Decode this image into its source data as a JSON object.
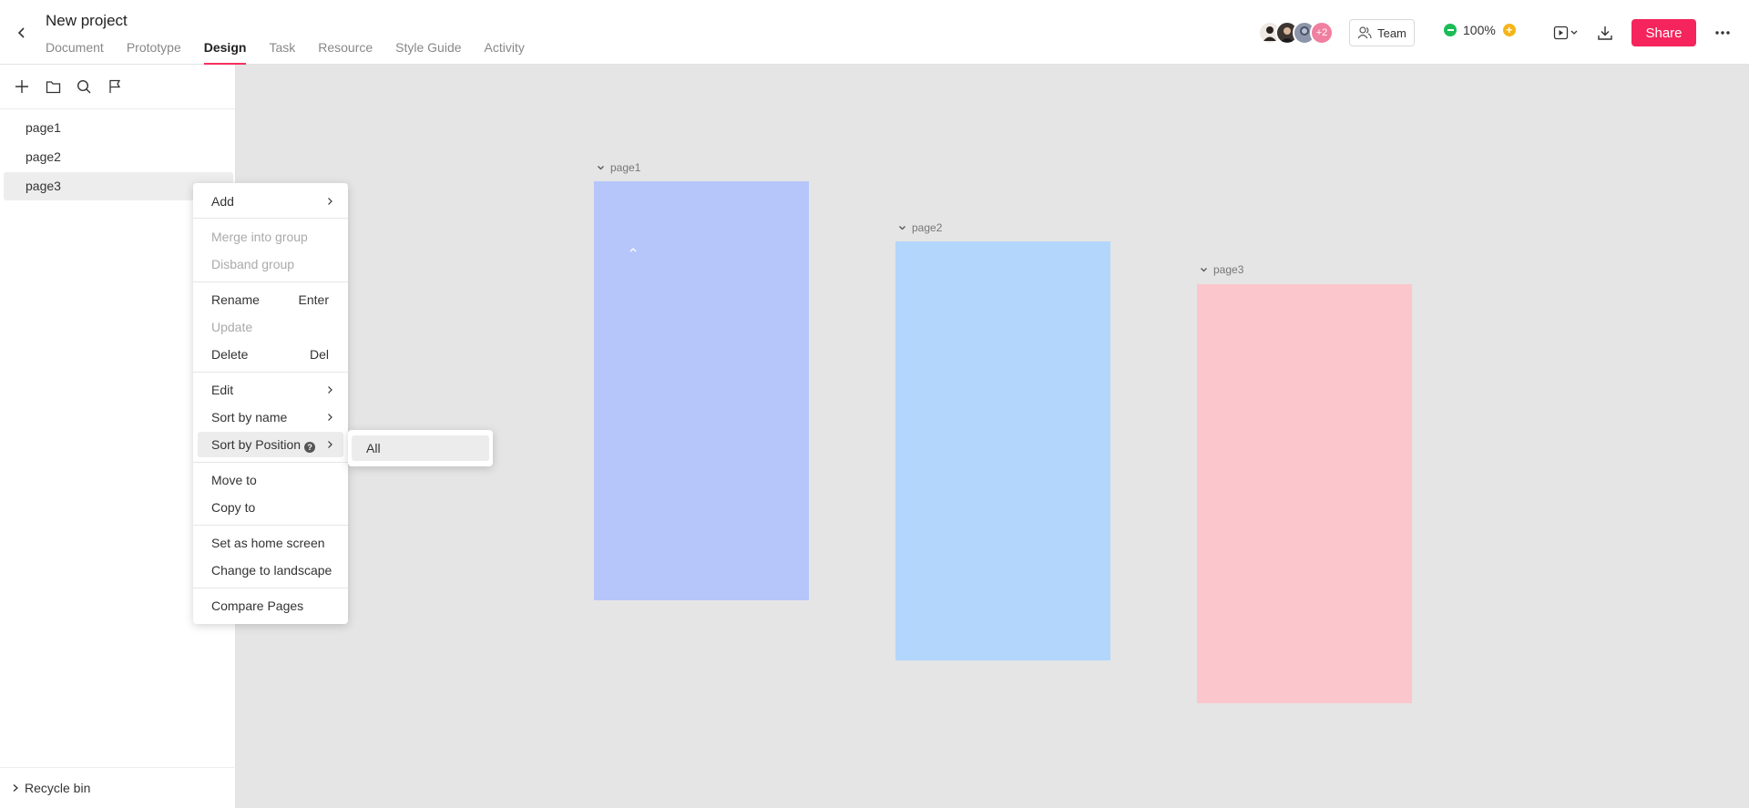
{
  "header": {
    "title": "New project",
    "tabs": [
      {
        "label": "Document"
      },
      {
        "label": "Prototype"
      },
      {
        "label": "Design",
        "active": true
      },
      {
        "label": "Task"
      },
      {
        "label": "Resource"
      },
      {
        "label": "Style Guide"
      },
      {
        "label": "Activity"
      }
    ],
    "collaborators_extra": "+2",
    "team_label": "Team",
    "zoom": "100%",
    "share_label": "Share",
    "accent_color": "#f5245c"
  },
  "sidebar": {
    "pages": [
      {
        "label": "page1"
      },
      {
        "label": "page2"
      },
      {
        "label": "page3",
        "selected": true
      }
    ],
    "recycle_label": "Recycle bin"
  },
  "canvas": {
    "background": "#e5e5e5",
    "frames": [
      {
        "label": "page1",
        "color": "#b6c6fb"
      },
      {
        "label": "page2",
        "color": "#b3d6fc"
      },
      {
        "label": "page3",
        "color": "#fbc6cc"
      }
    ]
  },
  "context_menu": {
    "items": [
      {
        "label": "Add",
        "submenu": true
      },
      {
        "label": "Merge into group",
        "disabled": true
      },
      {
        "label": "Disband group",
        "disabled": true
      },
      {
        "label": "Rename",
        "shortcut": "Enter"
      },
      {
        "label": "Update",
        "disabled": true
      },
      {
        "label": "Delete",
        "shortcut": "Del"
      },
      {
        "label": "Edit",
        "submenu": true
      },
      {
        "label": "Sort by name",
        "submenu": true
      },
      {
        "label": "Sort by Position",
        "submenu": true,
        "highlighted": true,
        "help": "?"
      },
      {
        "label": "Move to"
      },
      {
        "label": "Copy to"
      },
      {
        "label": "Set as home screen"
      },
      {
        "label": "Change to landscape"
      },
      {
        "label": "Compare Pages"
      }
    ],
    "submenu_items": [
      {
        "label": "All"
      }
    ]
  }
}
